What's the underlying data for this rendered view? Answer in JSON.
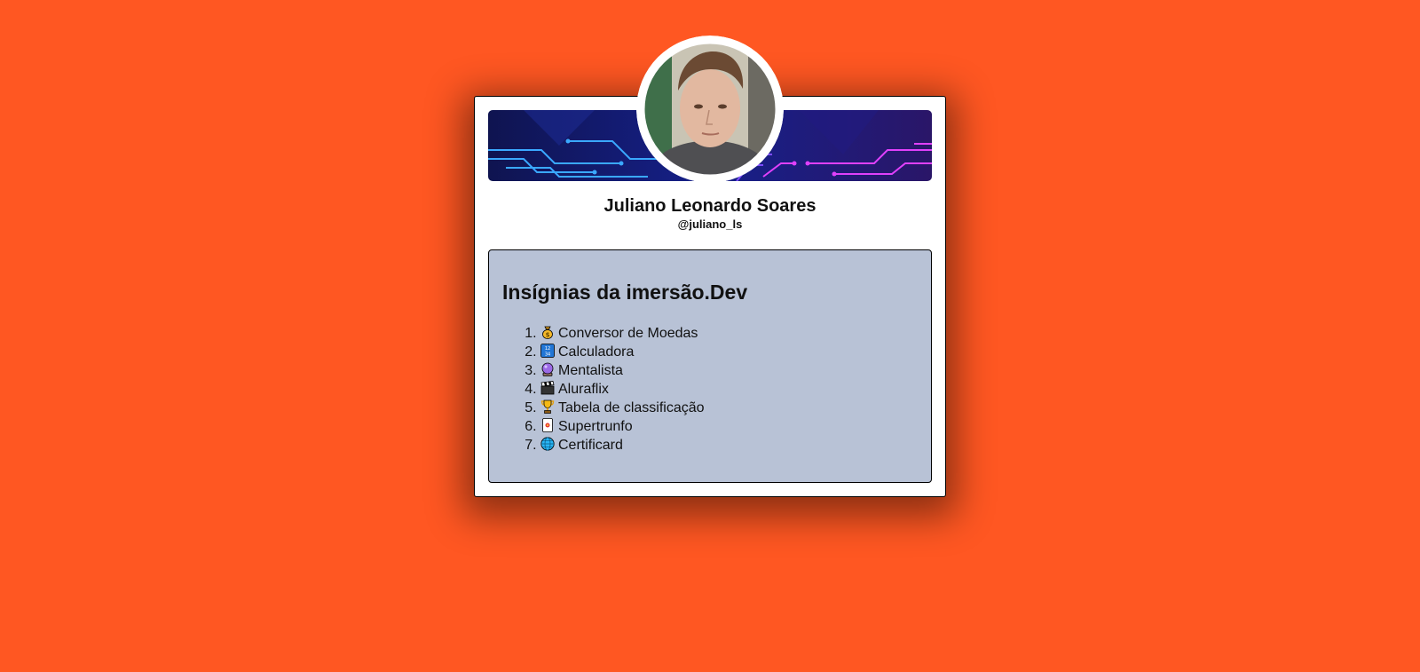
{
  "profile": {
    "name": "Juliano Leonardo Soares",
    "handle": "@juliano_ls",
    "avatar_icon": "profile-photo",
    "banner_icon": "circuit-board-banner"
  },
  "badges": {
    "title": "Insígnias da imersão.Dev",
    "items": [
      {
        "icon": "money-bag-icon",
        "label": "Conversor de Moedas"
      },
      {
        "icon": "input-numbers-icon",
        "label": "Calculadora"
      },
      {
        "icon": "crystal-ball-icon",
        "label": "Mentalista"
      },
      {
        "icon": "clapper-board-icon",
        "label": "Aluraflix"
      },
      {
        "icon": "trophy-icon",
        "label": "Tabela de classificação"
      },
      {
        "icon": "joker-card-icon",
        "label": "Supertrunfo"
      },
      {
        "icon": "globe-icon",
        "label": "Certificard"
      }
    ]
  },
  "colors": {
    "background": "#ff5722",
    "card": "#ffffff",
    "badges_panel": "#b8c2d6",
    "text": "#111111"
  }
}
